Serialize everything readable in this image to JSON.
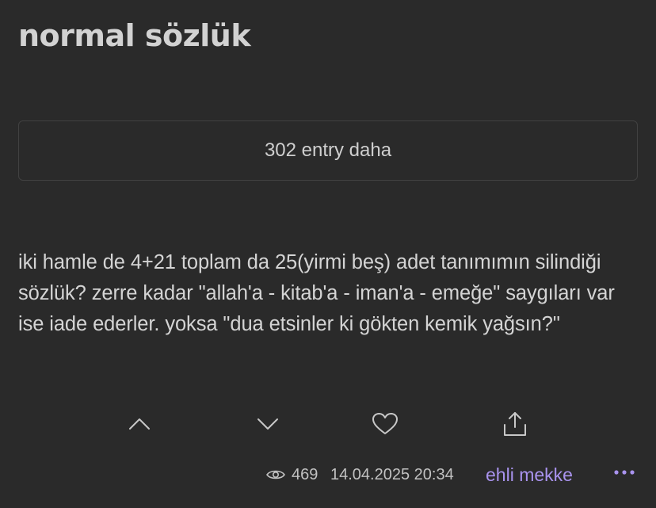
{
  "page": {
    "title": "normal sözlük"
  },
  "more_entries": {
    "label": "302 entry daha"
  },
  "entry": {
    "text": "iki hamle de 4+21 toplam da 25(yirmi beş) adet tanımımın silindiği sözlük? zerre kadar \"allah'a - kitab'a - iman'a - emeğe\" saygıları var ise iade ederler. yoksa \"dua etsinler ki gökten kemik yağsın?\"",
    "views": "469",
    "timestamp": "14.04.2025 20:34",
    "author": "ehli mekke"
  },
  "actions": {
    "upvote_icon": "chevron-up-icon",
    "downvote_icon": "chevron-down-icon",
    "favorite_icon": "heart-icon",
    "share_icon": "share-icon",
    "more_icon": "ellipsis-icon",
    "views_icon": "eye-icon"
  },
  "colors": {
    "background": "#2a2a2a",
    "text": "#d4d4d4",
    "author": "#a993ee",
    "more_dots": "#a993ee",
    "box_border": "#414141"
  }
}
